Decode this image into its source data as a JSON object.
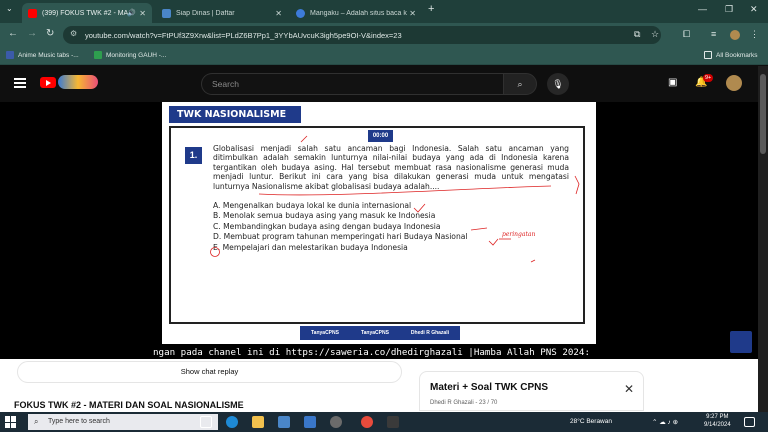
{
  "browser": {
    "tabs": [
      {
        "label": "(399) FOKUS TWK #2 - MA",
        "active": true
      },
      {
        "label": "Siap Dinas | Daftar",
        "active": false
      },
      {
        "label": "Mangaku – Adalah situs baca k",
        "active": false
      }
    ],
    "new_tab": "+",
    "url": "youtube.com/watch?v=FtPUf3Z9Xrw&list=PLdZ6B7Pp1_3YYbAUvcuK3igh5pe9OI-V&index=23",
    "bookmarks": [
      "Anime Music tabs -...",
      "Monitoring GAUH -..."
    ],
    "all_bookmarks": "All Bookmarks",
    "window_controls": [
      "—",
      "❐",
      "✕"
    ]
  },
  "youtube": {
    "search_placeholder": "Search",
    "notif_count": "9+"
  },
  "slide": {
    "header": "TWK NASIONALISME",
    "timer": "00:00",
    "question_number": "1.",
    "question_text": "Globalisasi menjadi salah satu ancaman bagi Indonesia. Salah satu ancaman yang ditimbulkan adalah semakin lunturnya nilai-nilai budaya yang ada di Indonesia karena tergantikan oleh budaya asing. Hal tersebut membuat rasa nasionalisme generasi muda menjadi luntur. Berikut ini cara yang bisa dilakukan generasi muda untuk mengatasi lunturnya Nasionalisme akibat globalisasi budaya adalah....",
    "options": [
      "A. Mengenalkan budaya lokal ke dunia internasional",
      "B. Menolak semua budaya asing yang masuk ke Indonesia",
      "C. Membandingkan budaya asing dengan budaya Indonesia",
      "D. Membuat program tahunan memperingati hari Budaya Nasional",
      "E. Mempelajari dan melestarikan budaya Indonesia"
    ],
    "hand_note": "peringatan",
    "social": [
      "TanyaCPNS",
      "TanyaCPNS",
      "Dhedi R Ghazali"
    ],
    "ticker": "ngan pada chanel ini di https://saweria.co/dhedirghazali |Hamba Allah PNS 2024:"
  },
  "page": {
    "chat_replay": "Show chat replay",
    "video_title": "FOKUS TWK #2 - MATERI DAN SOAL NASIONALISME",
    "playlist_title": "Materi + Soal TWK CPNS",
    "playlist_sub": "Dhedi R Ghazali - 23 / 70"
  },
  "taskbar": {
    "search_placeholder": "Type here to search",
    "weather": "28°C  Berawan",
    "time": "9:27 PM",
    "date": "9/14/2024"
  }
}
